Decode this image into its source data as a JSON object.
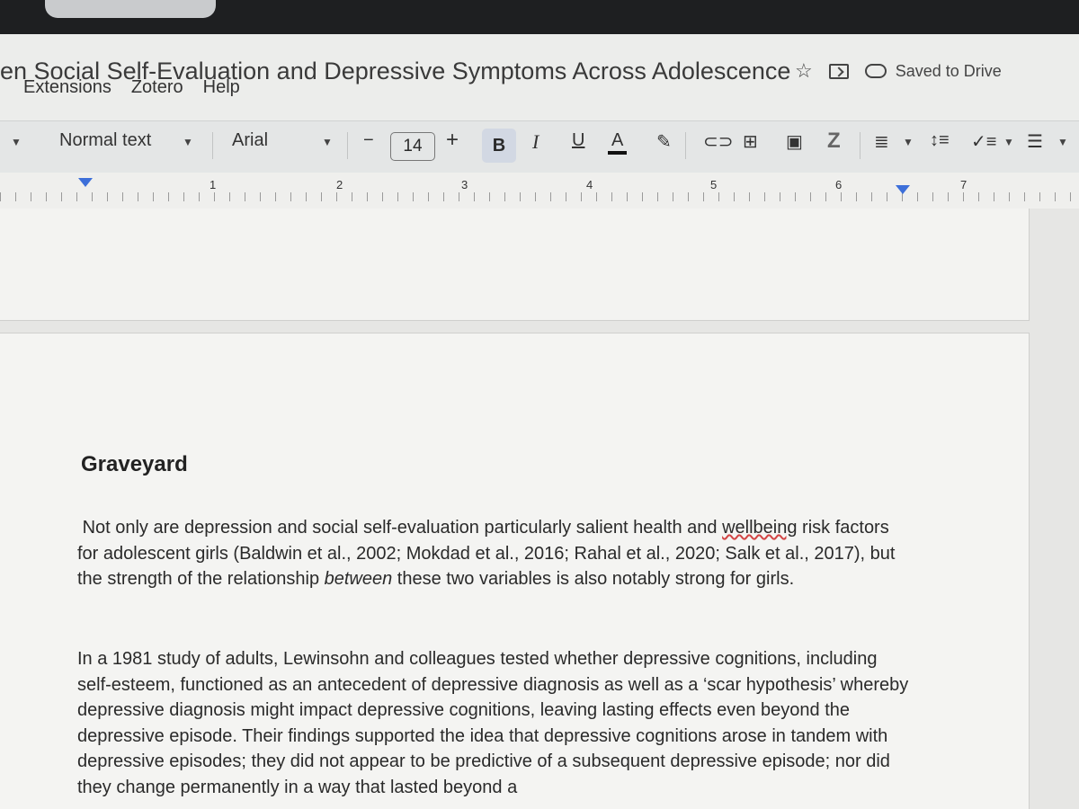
{
  "header": {
    "doc_title": "en Social Self-Evaluation and Depressive Symptoms Across Adolescence",
    "saved_status": "Saved to Drive",
    "menu_items": [
      "Extensions",
      "Zotero",
      "Help"
    ]
  },
  "toolbar": {
    "style": "Normal text",
    "font": "Arial",
    "font_size": "14",
    "minus": "−",
    "plus": "+",
    "bold": "B",
    "italic": "I",
    "underline": "U",
    "text_color": "A"
  },
  "ruler": {
    "numbers": [
      "1",
      "2",
      "3",
      "4",
      "5",
      "6",
      "7"
    ]
  },
  "document": {
    "heading": "Graveyard",
    "p1_a": "Not only are depression and social self-evaluation particularly salient health and ",
    "p1_misspelled": "wellbeing",
    "p1_b": " risk factors for adolescent girls (Baldwin et al., 2002; Mokdad et al., 2016; Rahal et al., 2020; Salk et al., 2017), but the strength of the relationship ",
    "p1_italic": "between",
    "p1_c": " these two variables is also notably strong for girls.",
    "p2": "In a 1981 study of adults, Lewinsohn and colleagues tested whether depressive cognitions, including self-esteem, functioned as an antecedent of depressive diagnosis as well as a ‘scar hypothesis’ whereby depressive diagnosis might impact depressive cognitions, leaving lasting effects even beyond the depressive episode. Their findings supported the idea that depressive cognitions arose in tandem with depressive episodes; they did not appear to be predictive of a subsequent depressive episode; nor did they change permanently in a way that lasted beyond a"
  },
  "colors": {
    "bold_active_bg": "#d2d8e3",
    "ruler_marker": "#3d6fd9",
    "spellcheck": "#d24545"
  }
}
